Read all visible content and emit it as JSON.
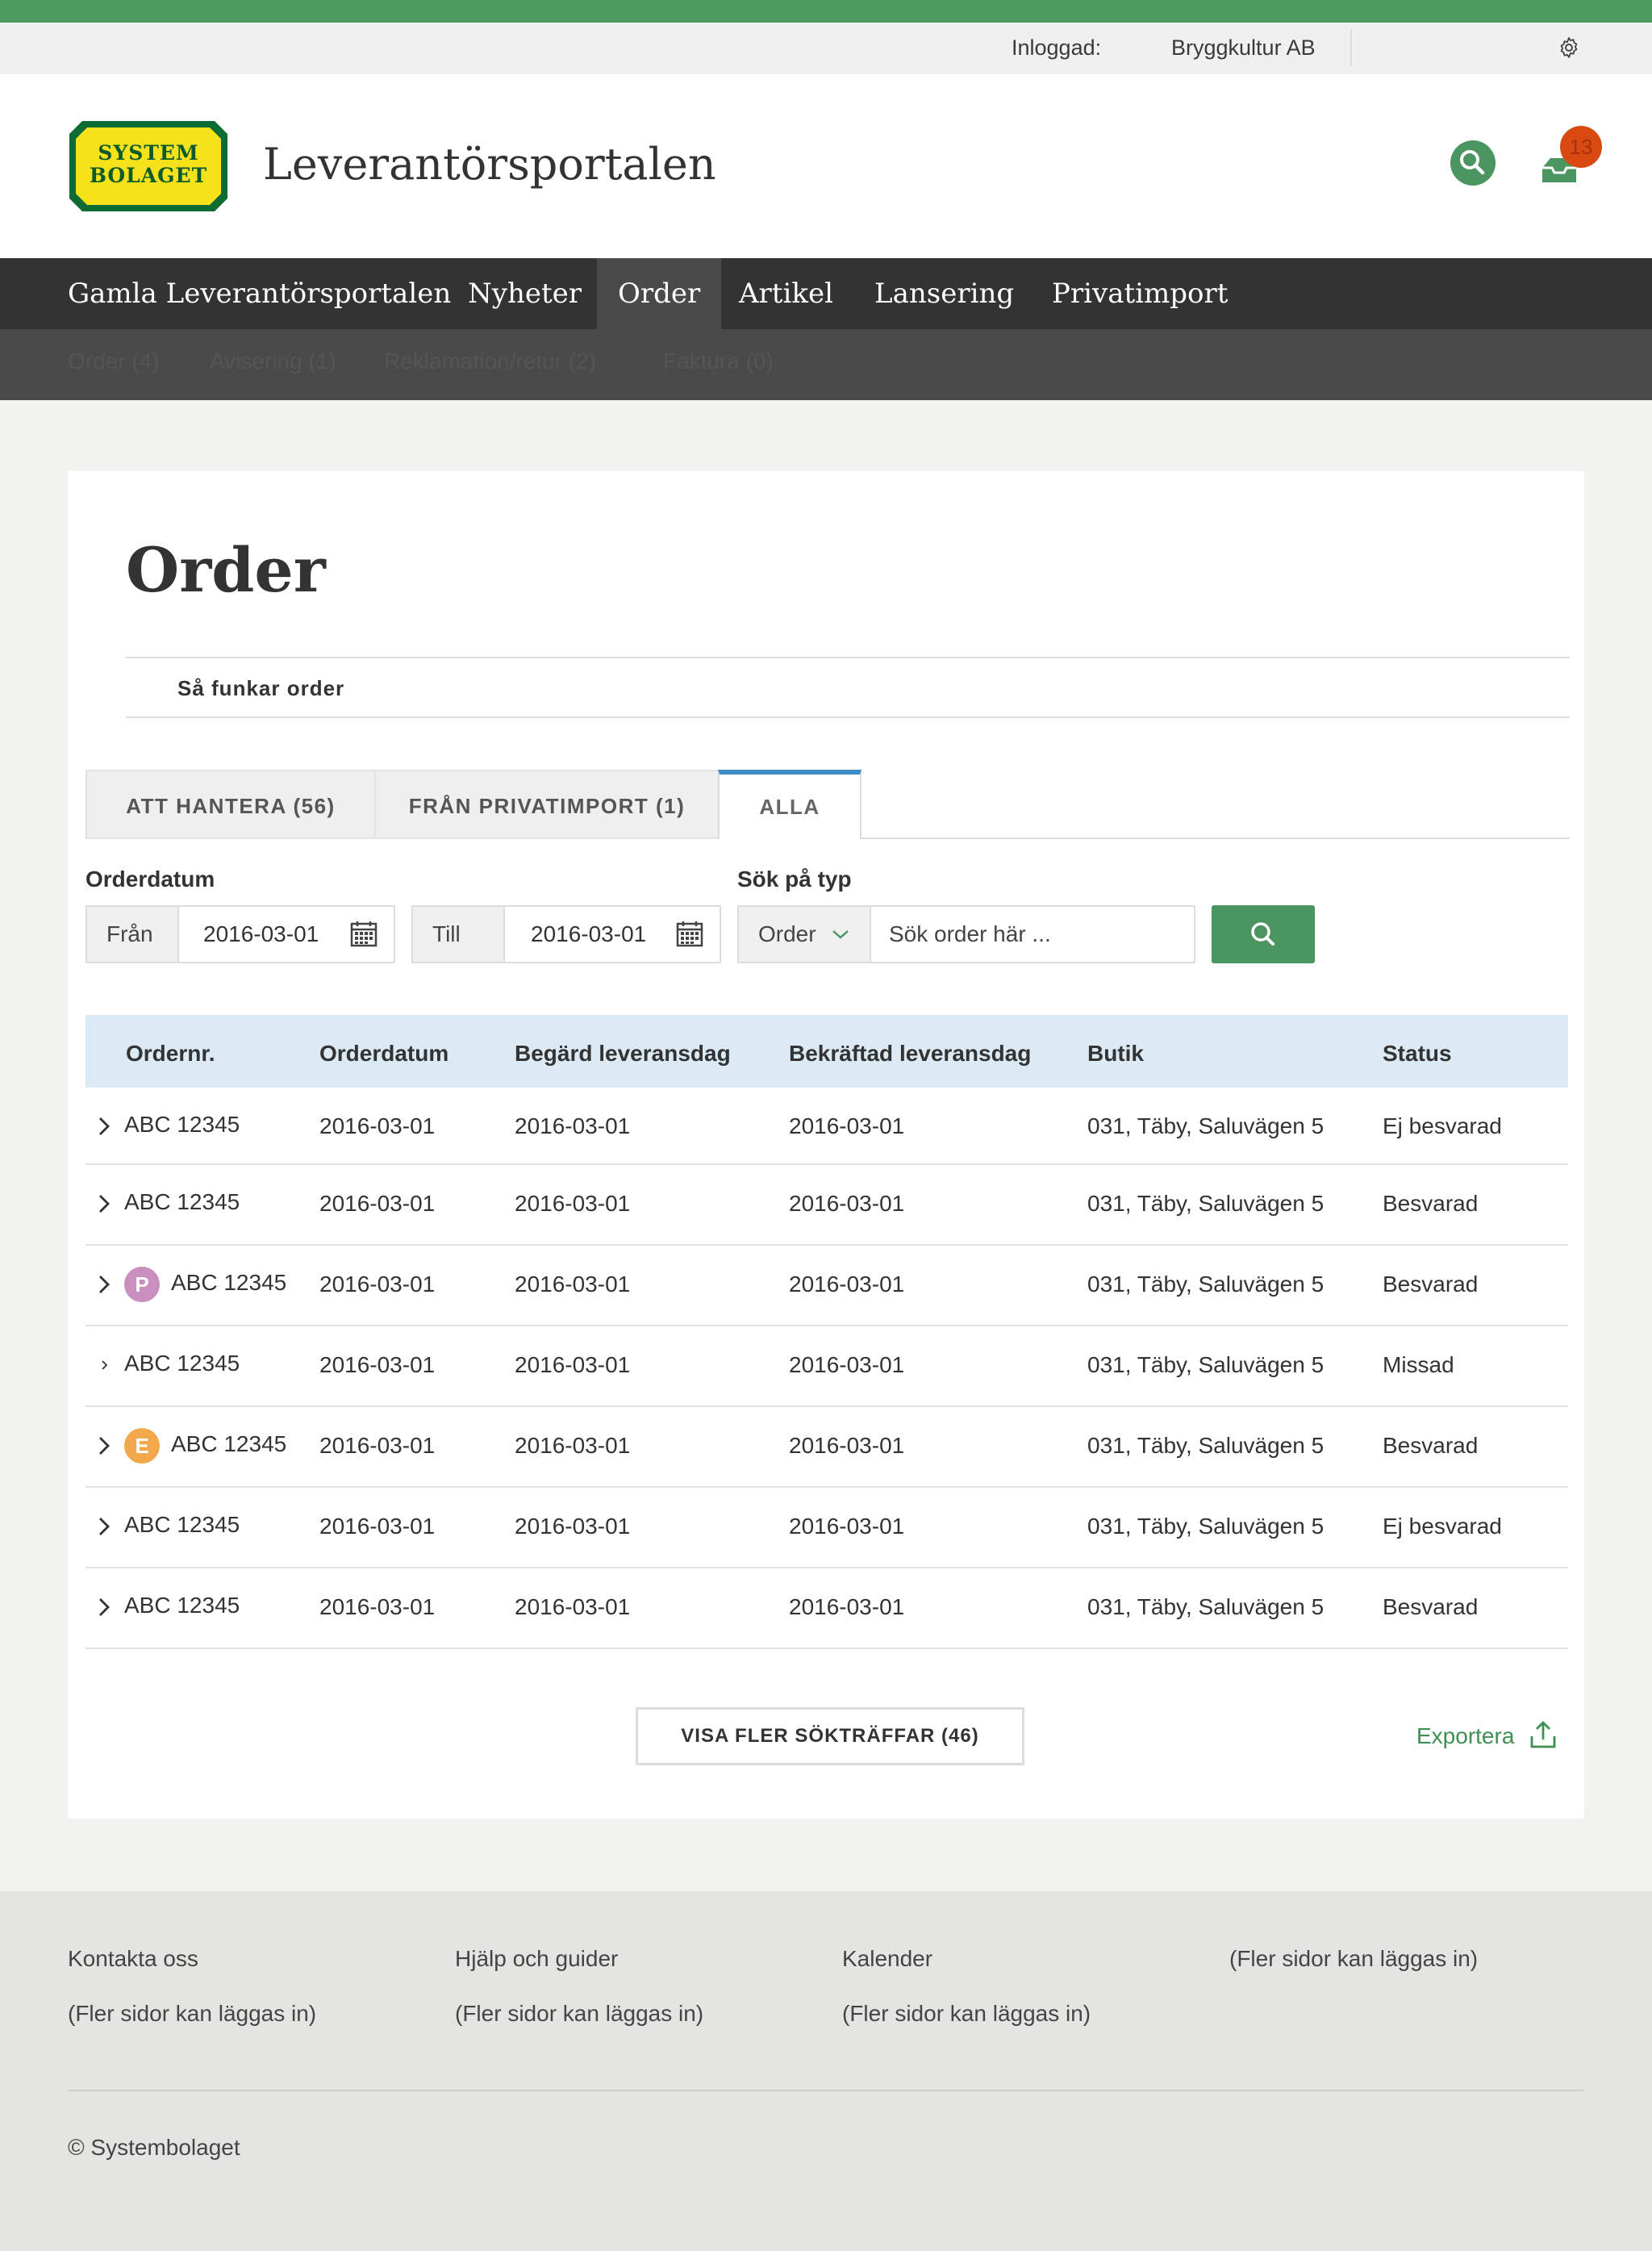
{
  "util": {
    "logged_in_label": "Inloggad:",
    "company": "Bryggkultur AB"
  },
  "header": {
    "logo_line1": "SYSTEM",
    "logo_line2": "BOLAGET",
    "site_title": "Leverantörsportalen",
    "inbox_count": "13"
  },
  "nav": {
    "items": [
      "Gamla Leverantörsportalen",
      "Nyheter",
      "Order",
      "Artikel",
      "Lansering",
      "Privatimport"
    ],
    "active": "Order"
  },
  "subnav": {
    "items": [
      "Order (4)",
      "Avisering (1)",
      "Reklamation/retur (2)",
      "Faktura (0)"
    ]
  },
  "page": {
    "title": "Order",
    "howto": "Så funkar order"
  },
  "tabs": [
    {
      "label": "ATT HANTERA (56)"
    },
    {
      "label": "FRÅN PRIVATIMPORT (1)"
    },
    {
      "label": "ALLA",
      "active": true
    }
  ],
  "filters": {
    "orderdatum_label": "Orderdatum",
    "from_label": "Från",
    "from_value": "2016-03-01",
    "to_label": "Till",
    "to_value": "2016-03-01",
    "type_label": "Sök på typ",
    "type_value": "Order",
    "search_placeholder": "Sök order här ..."
  },
  "table": {
    "columns": [
      "Ordernr.",
      "Orderdatum",
      "Begärd leveransdag",
      "Bekräftad leveransdag",
      "Butik",
      "Status"
    ],
    "rows": [
      {
        "order": "ABC 12345",
        "badge": "",
        "orderdatum": "2016-03-01",
        "begard": "2016-03-01",
        "bekraftad": "2016-03-01",
        "butik": "031, Täby, Saluvägen 5",
        "status": "Ej besvarad"
      },
      {
        "order": "ABC 12345",
        "badge": "",
        "orderdatum": "2016-03-01",
        "begard": "2016-03-01",
        "bekraftad": "2016-03-01",
        "butik": "031, Täby, Saluvägen 5",
        "status": "Besvarad"
      },
      {
        "order": "ABC 12345",
        "badge": "P",
        "orderdatum": "2016-03-01",
        "begard": "2016-03-01",
        "bekraftad": "2016-03-01",
        "butik": "031, Täby, Saluvägen 5",
        "status": "Besvarad"
      },
      {
        "order": "ABC 12345",
        "badge": "",
        "orderdatum": "2016-03-01",
        "begard": "2016-03-01",
        "bekraftad": "2016-03-01",
        "butik": "031, Täby, Saluvägen 5",
        "status": "Missad"
      },
      {
        "order": "ABC 12345",
        "badge": "E",
        "orderdatum": "2016-03-01",
        "begard": "2016-03-01",
        "bekraftad": "2016-03-01",
        "butik": "031, Täby, Saluvägen 5",
        "status": "Besvarad"
      },
      {
        "order": "ABC 12345",
        "badge": "",
        "orderdatum": "2016-03-01",
        "begard": "2016-03-01",
        "bekraftad": "2016-03-01",
        "butik": "031, Täby, Saluvägen 5",
        "status": "Ej besvarad"
      },
      {
        "order": "ABC 12345",
        "badge": "",
        "orderdatum": "2016-03-01",
        "begard": "2016-03-01",
        "bekraftad": "2016-03-01",
        "butik": "031, Täby, Saluvägen 5",
        "status": "Besvarad"
      }
    ]
  },
  "actions": {
    "show_more": "VISA FLER SÖKTRÄFFAR (46)",
    "export": "Exportera"
  },
  "footer": {
    "columns": [
      {
        "title": "Kontakta oss",
        "sub": "(Fler sidor kan läggas in)"
      },
      {
        "title": "Hjälp och guider",
        "sub": "(Fler sidor kan läggas in)"
      },
      {
        "title": "Kalender",
        "sub": "(Fler sidor kan läggas in)"
      },
      {
        "title": "(Fler sidor kan läggas in)",
        "sub": ""
      }
    ],
    "copyright": "© Systembolaget"
  },
  "colors": {
    "brand_green": "#4f9a61",
    "nav_dark": "#333333",
    "accent_blue": "#3d8ec9",
    "badge_p": "#c98fbf",
    "badge_e": "#f3a94b",
    "notification": "#d94a12"
  }
}
